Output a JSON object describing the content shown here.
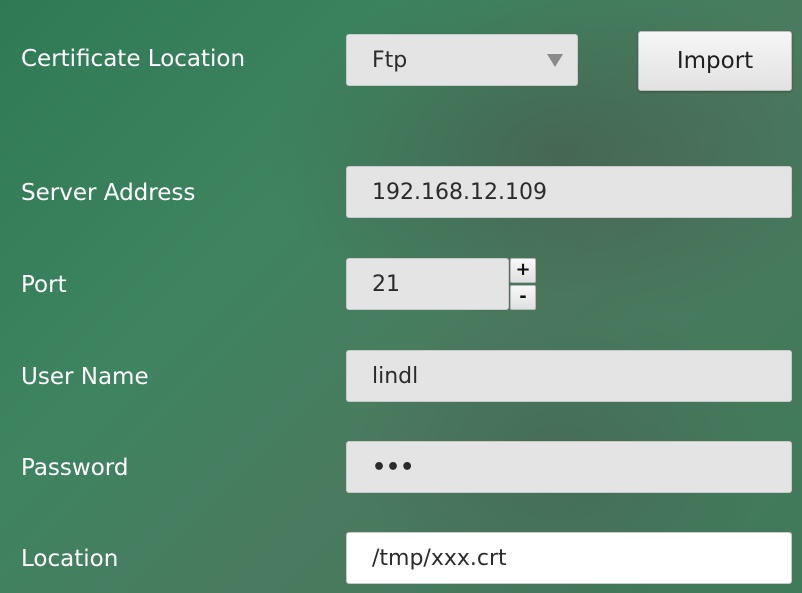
{
  "certificate_location": {
    "label": "Certificate Location",
    "selected": "Ftp",
    "import_label": "Import"
  },
  "server_address": {
    "label": "Server Address",
    "value": "192.168.12.109"
  },
  "port": {
    "label": "Port",
    "value": "21",
    "increment_label": "+",
    "decrement_label": "-"
  },
  "user_name": {
    "label": "User Name",
    "value": "lindl"
  },
  "password": {
    "label": "Password",
    "value": "•••"
  },
  "location": {
    "label": "Location",
    "value": "/tmp/xxx.crt"
  }
}
